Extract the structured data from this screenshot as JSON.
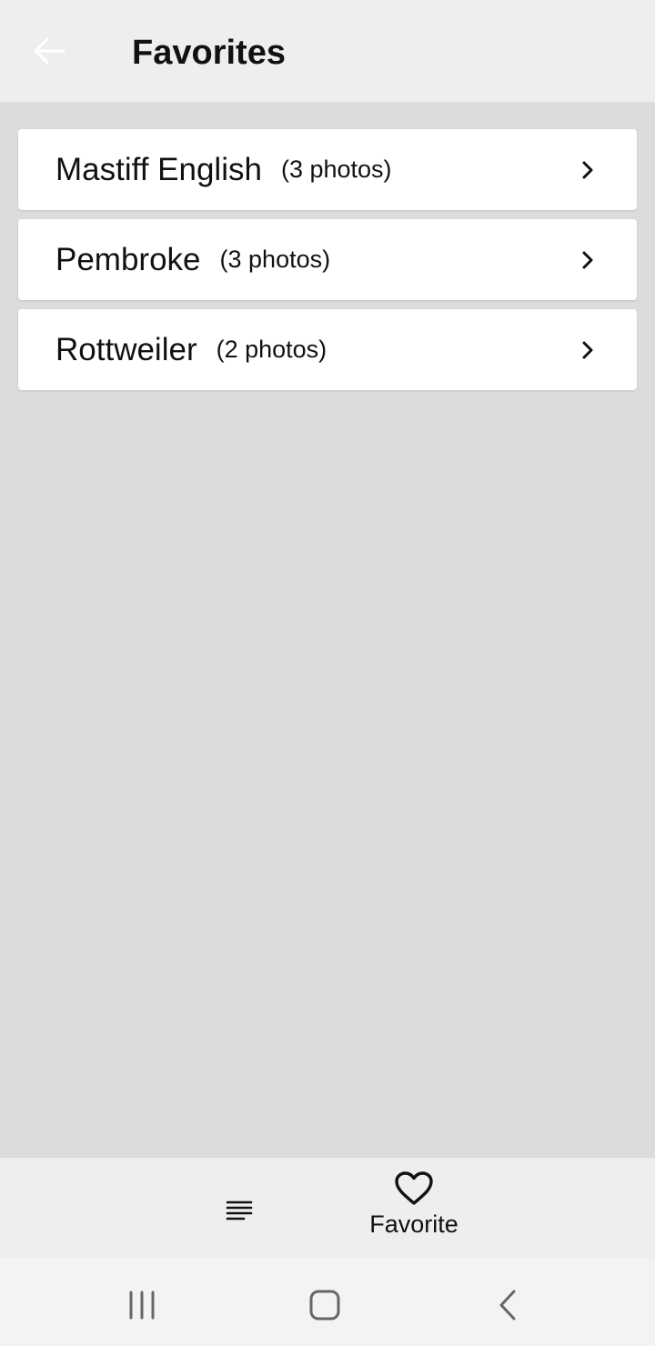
{
  "app_bar": {
    "title": "Favorites",
    "back_icon": "arrow-left-icon"
  },
  "favorites": [
    {
      "name": "Mastiff English",
      "count": "(3 photos)"
    },
    {
      "name": "Pembroke",
      "count": "(3 photos)"
    },
    {
      "name": "Rottweiler",
      "count": "(2 photos)"
    }
  ],
  "bottom_nav": {
    "list_icon": "list-icon",
    "favorite_icon": "heart-icon",
    "favorite_label": "Favorite"
  },
  "system_nav": {
    "recents_icon": "recents-icon",
    "home_icon": "home-icon",
    "back_icon": "back-chevron-icon"
  },
  "colors": {
    "background": "#dcdcdc",
    "bar": "#eeeeee",
    "card": "#ffffff",
    "text": "#111111",
    "back_arrow": "#ffffff"
  }
}
